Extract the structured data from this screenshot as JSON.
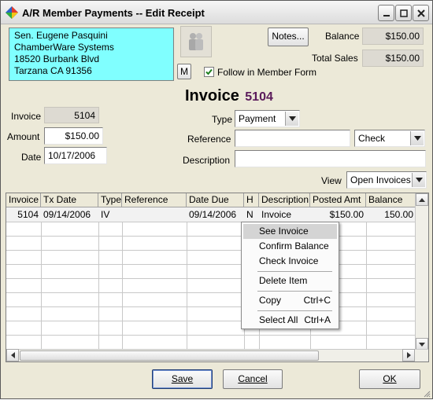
{
  "window": {
    "title": "A/R Member Payments -- Edit Receipt"
  },
  "member": {
    "lines": [
      "Sen. Eugene Pasquini",
      "ChamberWare Systems",
      "18520 Burbank Blvd",
      "Tarzana CA 91356"
    ],
    "m_button": "M",
    "follow_label": "Follow in Member Form",
    "follow_checked": true
  },
  "notes_label": "Notes...",
  "balance": {
    "label": "Balance",
    "value": "$150.00"
  },
  "total_sales": {
    "label": "Total Sales",
    "value": "$150.00"
  },
  "heading": {
    "text": "Invoice",
    "number": "5104"
  },
  "fields": {
    "invoice": {
      "label": "Invoice",
      "value": "5104"
    },
    "amount": {
      "label": "Amount",
      "value": "$150.00"
    },
    "date": {
      "label": "Date",
      "value": "10/17/2006"
    },
    "type": {
      "label": "Type",
      "value": "Payment"
    },
    "reference": {
      "label": "Reference",
      "value": ""
    },
    "method": {
      "value": "Check"
    },
    "description": {
      "label": "Description",
      "value": ""
    },
    "view": {
      "label": "View",
      "value": "Open Invoices"
    }
  },
  "grid": {
    "columns": [
      "Invoice",
      "Tx Date",
      "Type",
      "Reference",
      "Date Due",
      "H",
      "Description",
      "Posted Amt",
      "Balance"
    ],
    "rows": [
      [
        "5104",
        "09/14/2006",
        "IV",
        "",
        "09/14/2006",
        "N",
        "Invoice",
        "$150.00",
        "150.00"
      ]
    ]
  },
  "context_menu": [
    {
      "label": "See Invoice",
      "shortcut": ""
    },
    {
      "label": "Confirm Balance",
      "shortcut": ""
    },
    {
      "label": "Check Invoice",
      "shortcut": ""
    },
    {
      "label": "Delete Item",
      "shortcut": ""
    },
    {
      "label": "Copy",
      "shortcut": "Ctrl+C"
    },
    {
      "label": "Select All",
      "shortcut": "Ctrl+A"
    }
  ],
  "buttons": {
    "save": "Save",
    "cancel": "Cancel",
    "ok": "OK"
  },
  "colors": {
    "member_bg": "#80ffff",
    "invoice_number": "#5a1a5a",
    "selected_menu": "#d4d4d4"
  }
}
